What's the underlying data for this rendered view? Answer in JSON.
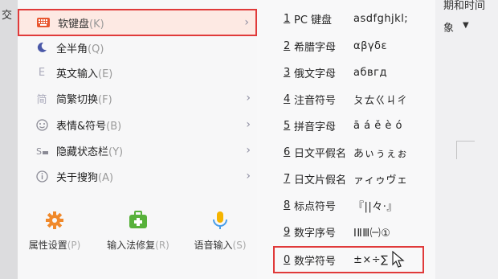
{
  "background": {
    "left_text": "交",
    "right_text_1": "期和时间",
    "right_text_2": "象"
  },
  "menu": {
    "items": [
      {
        "label": "软键盘",
        "shortcut": "(K)",
        "icon": "keyboard-icon",
        "has_submenu": true,
        "highlighted": true
      },
      {
        "label": "全半角",
        "shortcut": "(Q)",
        "icon": "moon-icon",
        "has_submenu": false
      },
      {
        "label": "英文输入",
        "shortcut": "(E)",
        "icon": "letter-e-icon",
        "has_submenu": false
      },
      {
        "label": "简繁切换",
        "shortcut": "(F)",
        "icon": "simplified-icon",
        "has_submenu": true
      },
      {
        "label": "表情&符号",
        "shortcut": "(B)",
        "icon": "smiley-icon",
        "has_submenu": true
      },
      {
        "label": "隐藏状态栏",
        "shortcut": "(Y)",
        "icon": "statusbar-icon",
        "has_submenu": true
      },
      {
        "label": "关于搜狗",
        "shortcut": "(A)",
        "icon": "info-icon",
        "has_submenu": true
      }
    ],
    "bottom": [
      {
        "label": "属性设置",
        "shortcut": "(P)",
        "icon": "gear-icon"
      },
      {
        "label": "输入法修复",
        "shortcut": "(R)",
        "icon": "repair-kit-icon"
      },
      {
        "label": "语音输入",
        "shortcut": "(S)",
        "icon": "microphone-icon"
      }
    ]
  },
  "submenu": {
    "items": [
      {
        "num": "1",
        "name": "PC 键盘",
        "sample": "asdfghjkl;"
      },
      {
        "num": "2",
        "name": "希腊字母",
        "sample": "αβγδε"
      },
      {
        "num": "3",
        "name": "俄文字母",
        "sample": "абвгд"
      },
      {
        "num": "4",
        "name": "注音符号",
        "sample": "ㄆㄊㄍㄐㄔ"
      },
      {
        "num": "5",
        "name": "拼音字母",
        "sample": "ā á ě è ó"
      },
      {
        "num": "6",
        "name": "日文平假名",
        "sample": "あぃぅぇぉ"
      },
      {
        "num": "7",
        "name": "日文片假名",
        "sample": "ァィゥヴェ"
      },
      {
        "num": "8",
        "name": "标点符号",
        "sample": "『||々·』"
      },
      {
        "num": "9",
        "name": "数字序号",
        "sample": "ⅠⅡⅢ㈠①"
      },
      {
        "num": "0",
        "name": "数学符号",
        "sample": "±×÷∑"
      }
    ]
  },
  "colors": {
    "highlight_border": "#e03a3a",
    "highlight_bg": "#fde9e3",
    "keyboard_icon": "#e8562f",
    "gear_icon": "#f0892b",
    "repair_icon": "#57b13a",
    "mic_icon": "#f5b400"
  }
}
